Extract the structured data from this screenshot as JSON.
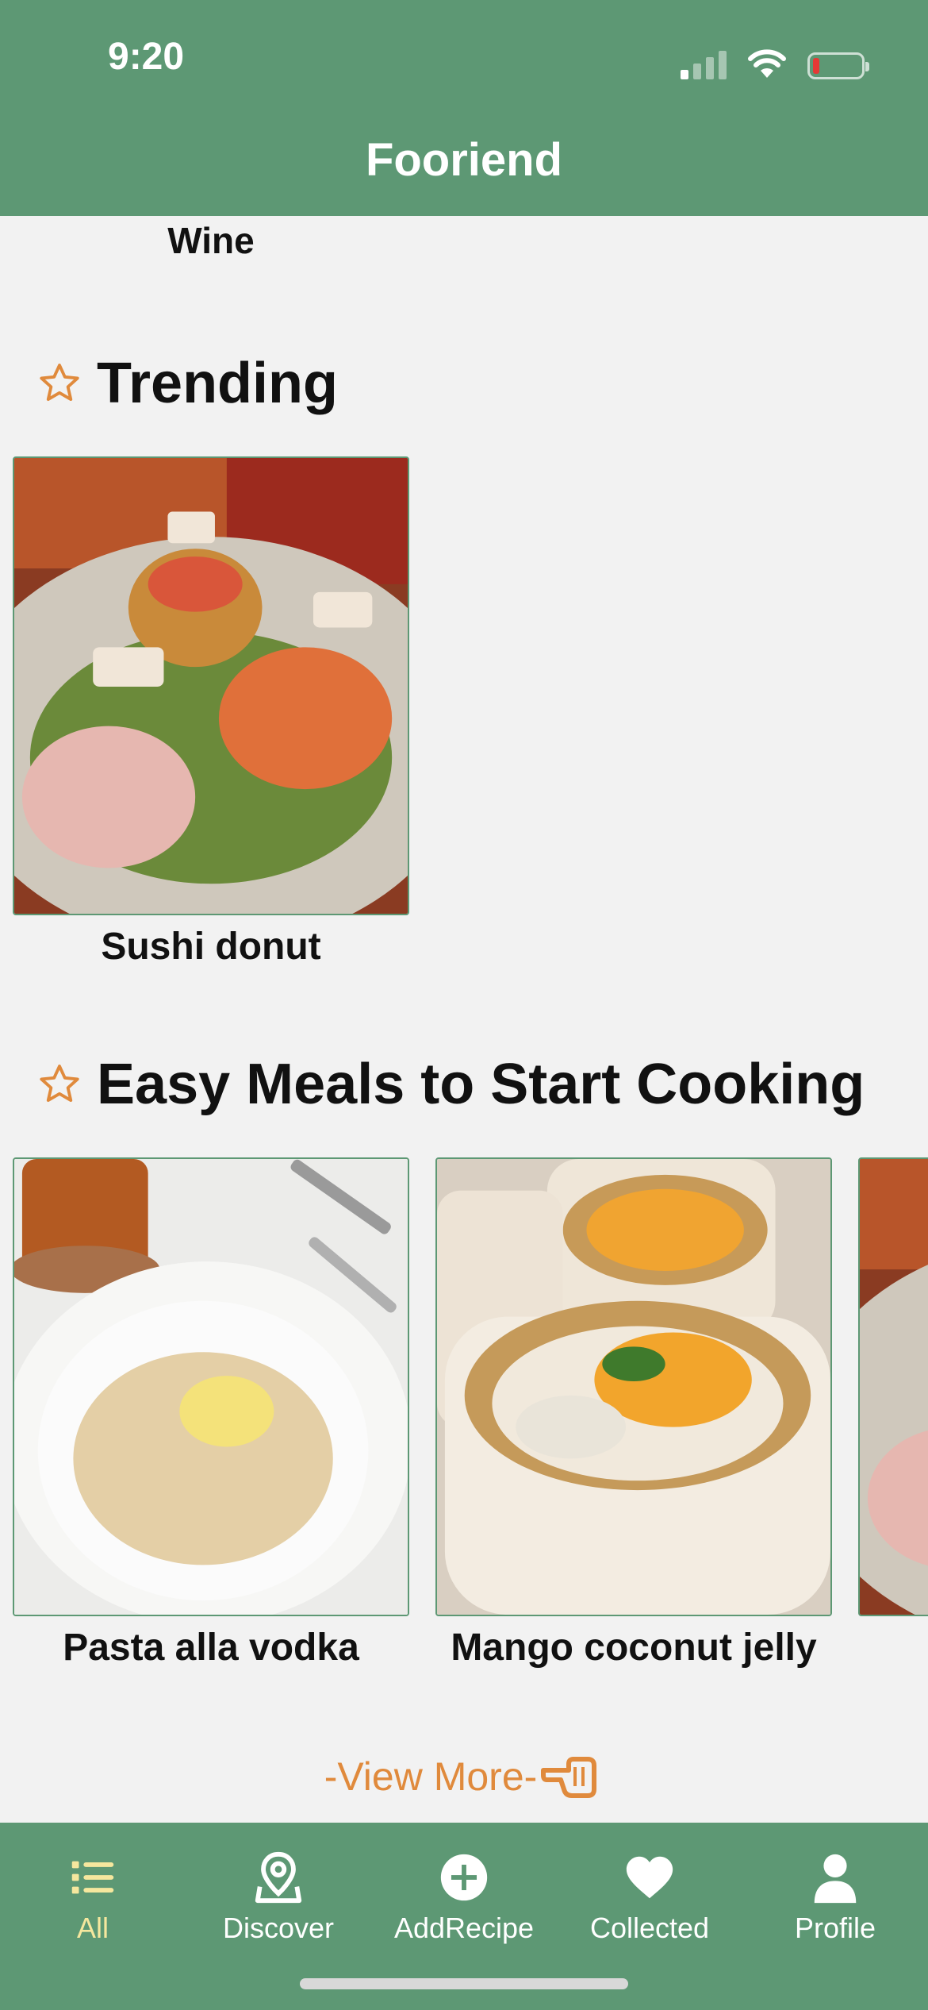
{
  "status_bar": {
    "time": "9:20"
  },
  "header": {
    "title": "Fooriend"
  },
  "top_partial": {
    "label": "Wine"
  },
  "sections": {
    "trending": {
      "title": "Trending",
      "items": [
        {
          "name": "Sushi donut"
        }
      ]
    },
    "easy_meals": {
      "title": "Easy Meals to Start Cooking",
      "items": [
        {
          "name": "Pasta alla vodka"
        },
        {
          "name": "Mango coconut jelly"
        }
      ]
    }
  },
  "view_more": {
    "label": "-View More-"
  },
  "tab_bar": {
    "active": "All",
    "items": [
      {
        "label": "All",
        "icon": "list-icon"
      },
      {
        "label": "Discover",
        "icon": "map-pin-icon"
      },
      {
        "label": "AddRecipe",
        "icon": "plus-circle-icon"
      },
      {
        "label": "Collected",
        "icon": "heart-icon"
      },
      {
        "label": "Profile",
        "icon": "person-icon"
      }
    ]
  },
  "colors": {
    "brand_green": "#5d9874",
    "accent_orange": "#e08a3c",
    "active_tab": "#f5e79e",
    "background": "#f2f2f2"
  }
}
